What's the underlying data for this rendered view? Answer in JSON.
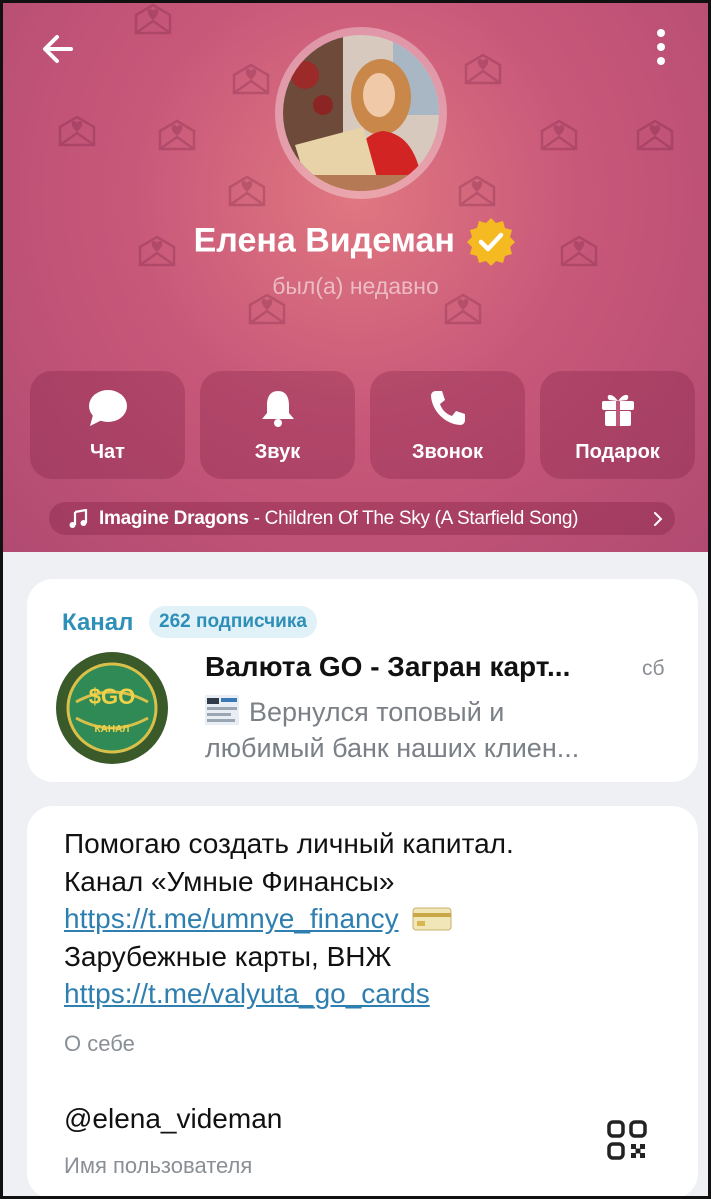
{
  "header": {
    "name": "Елена Видеман",
    "status": "был(а) недавно",
    "accent_color": "#c8587a",
    "verified_color": "#f5b921"
  },
  "actions": [
    {
      "label": "Чат",
      "icon": "chat-bubble-icon"
    },
    {
      "label": "Звук",
      "icon": "bell-icon"
    },
    {
      "label": "Звонок",
      "icon": "phone-icon"
    },
    {
      "label": "Подарок",
      "icon": "gift-icon"
    }
  ],
  "music": {
    "artist": "Imagine Dragons",
    "separator": " - ",
    "title": "Children Of The Sky (A Starfield Song)"
  },
  "channel": {
    "label": "Канал",
    "subscribers": "262 подписчика",
    "name": "Валюта GO - Загран карт...",
    "time": "сб",
    "message_line1": "Вернулся топовый и",
    "message_line2": "любимый банк наших клиен...",
    "avatar_text": "КАНАЛ"
  },
  "about": {
    "line1": "Помогаю создать личный капитал.",
    "line2": "Канал «Умные Финансы»",
    "link1": "https://t.me/umnye_financy",
    "line3": "Зарубежные карты, ВНЖ",
    "link2": "https://t.me/valyuta_go_cards",
    "bio_label": "О себе",
    "username": "@elena_videman",
    "username_label": "Имя пользователя"
  }
}
